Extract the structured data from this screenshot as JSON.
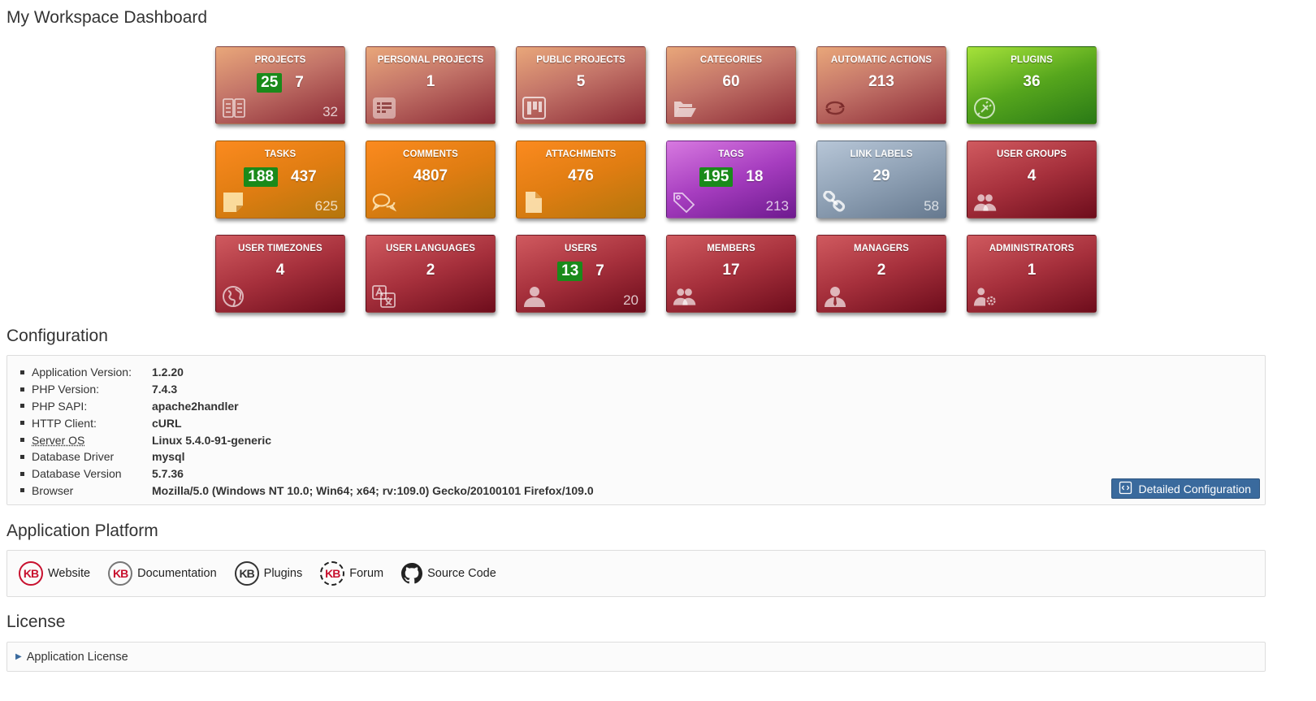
{
  "page_title": "My Workspace Dashboard",
  "tiles": [
    {
      "label": "PROJECTS",
      "badge": "25",
      "value": "7",
      "total": "32",
      "icon": "project-cards-icon"
    },
    {
      "label": "PERSONAL PROJECTS",
      "badge": "",
      "value": "1",
      "total": "",
      "icon": "grid-list-icon"
    },
    {
      "label": "PUBLIC PROJECTS",
      "badge": "",
      "value": "5",
      "total": "",
      "icon": "board-columns-icon"
    },
    {
      "label": "CATEGORIES",
      "badge": "",
      "value": "60",
      "total": "",
      "icon": "folder-open-icon"
    },
    {
      "label": "AUTOMATIC ACTIONS",
      "badge": "",
      "value": "213",
      "total": "",
      "icon": "recycle-arrows-icon"
    },
    {
      "label": "PLUGINS",
      "badge": "",
      "value": "36",
      "total": "",
      "icon": "plug-icon"
    },
    {
      "label": "TASKS",
      "badge": "188",
      "value": "437",
      "total": "625",
      "icon": "sticky-note-icon"
    },
    {
      "label": "COMMENTS",
      "badge": "",
      "value": "4807",
      "total": "",
      "icon": "chat-bubbles-icon"
    },
    {
      "label": "ATTACHMENTS",
      "badge": "",
      "value": "476",
      "total": "",
      "icon": "file-icon"
    },
    {
      "label": "TAGS",
      "badge": "195",
      "value": "18",
      "total": "213",
      "icon": "tags-icon"
    },
    {
      "label": "LINK LABELS",
      "badge": "",
      "value": "29",
      "total": "58",
      "icon": "chain-link-icon"
    },
    {
      "label": "USER GROUPS",
      "badge": "",
      "value": "4",
      "total": "",
      "icon": "users-group-icon"
    },
    {
      "label": "USER TIMEZONES",
      "badge": "",
      "value": "4",
      "total": "",
      "icon": "globe-icon"
    },
    {
      "label": "USER LANGUAGES",
      "badge": "",
      "value": "2",
      "total": "",
      "icon": "translate-icon"
    },
    {
      "label": "USERS",
      "badge": "13",
      "value": "7",
      "total": "20",
      "icon": "user-icon"
    },
    {
      "label": "MEMBERS",
      "badge": "",
      "value": "17",
      "total": "",
      "icon": "users-group-icon"
    },
    {
      "label": "MANAGERS",
      "badge": "",
      "value": "2",
      "total": "",
      "icon": "user-tie-icon"
    },
    {
      "label": "ADMINISTRATORS",
      "badge": "",
      "value": "1",
      "total": "",
      "icon": "user-gear-icon"
    }
  ],
  "colors": {
    "badge_green": "#1a8a1a",
    "button_blue": "#3a6a9d"
  },
  "configuration": {
    "title": "Configuration",
    "items": [
      {
        "label": "Application Version:",
        "value": "1.2.20"
      },
      {
        "label": "PHP Version:",
        "value": "7.4.3"
      },
      {
        "label": "PHP SAPI:",
        "value": "apache2handler"
      },
      {
        "label": "HTTP Client:",
        "value": "cURL"
      },
      {
        "label": "Server OS",
        "value": "Linux 5.4.0-91-generic"
      },
      {
        "label": "Database Driver",
        "value": "mysql"
      },
      {
        "label": "Database Version",
        "value": "5.7.36"
      },
      {
        "label": "Browser",
        "value": "Mozilla/5.0 (Windows NT 10.0; Win64; x64; rv:109.0) Gecko/20100101 Firefox/109.0"
      }
    ],
    "detail_button": "Detailed Configuration"
  },
  "platform": {
    "title": "Application Platform",
    "links": [
      {
        "label": "Website",
        "logo": "KB"
      },
      {
        "label": "Documentation",
        "logo": "KB"
      },
      {
        "label": "Plugins",
        "logo": "KB"
      },
      {
        "label": "Forum",
        "logo": "KB"
      },
      {
        "label": "Source Code",
        "logo": "github-icon"
      }
    ]
  },
  "license": {
    "title": "License",
    "summary": "Application License"
  }
}
